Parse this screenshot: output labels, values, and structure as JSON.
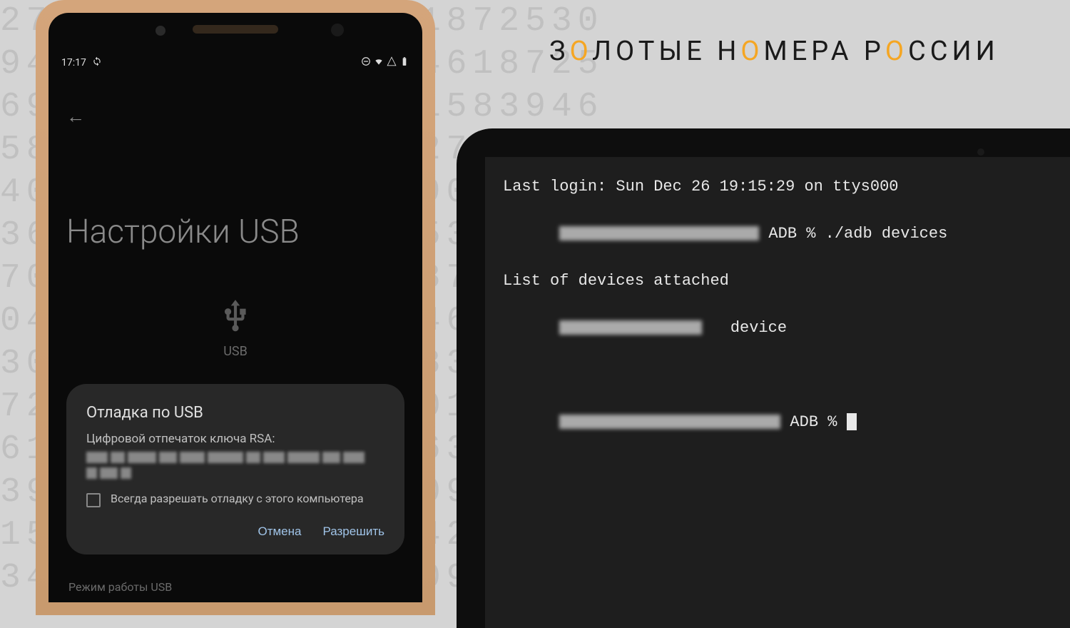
{
  "logo": {
    "prefix1": "З",
    "hl1": "О",
    "mid1": "ЛОТЫЕ Н",
    "hl2": "О",
    "mid2": "МЕРА Р",
    "hl3": "О",
    "suffix": "ССИИ"
  },
  "bg_numbers": "27093634015839461872530\n94270936340158394618725\n69309042709363401583946\n58394618725309042709363\n40158394618725309042709\n36340158394618725309042\n70936340158394618725309\n04270936340158394618725\n30904270936340158394618\n72530904270936340158394\n61872530904270936340158\n39461872530904270936340\n15839461872530904270936\n34015839461872530904270",
  "phone": {
    "status": {
      "time": "17:17",
      "sync_icon": "sync"
    },
    "back_icon": "←",
    "page_title": "Настройки USB",
    "usb_label": "USB",
    "dialog": {
      "title": "Отладка по USB",
      "subtitle": "Цифровой отпечаток ключа RSA:",
      "checkbox_label": "Всегда разрешать отладку с этого компьютера",
      "cancel": "Отмена",
      "allow": "Разрешить"
    },
    "bottom_text": "Режим работы USB"
  },
  "terminal": {
    "line1": "Last login: Sun Dec 26 19:15:29 on ttys000",
    "prompt_suffix": " ADB % ",
    "cmd1": "./adb devices",
    "line3": "List of devices attached",
    "device_label": "device"
  }
}
